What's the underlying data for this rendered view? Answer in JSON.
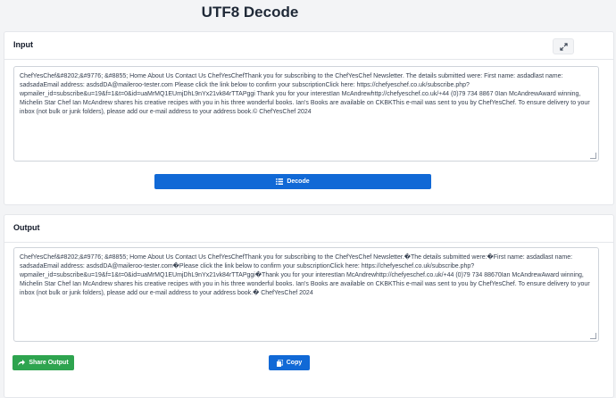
{
  "page": {
    "title": "UTF8 Decode"
  },
  "input": {
    "header": "Input",
    "text": "ChefYesChef&#8202;&#9776; &#8855; Home  About Us  Contact Us ChefYesChefThank you for subscribing to the ChefYesChef Newsletter. The details submitted were: First name: asdadlast name: sadsadaEmail address: asdsdDA@maileroo-tester.com Please click the link below to confirm your subscriptionClick here: https://chefyeschef.co.uk/subscribe.php?wpmailer_id=subscribe&u=19&f=1&t=0&id=uaMrMQ1EUmjDhL9nYx21vk84rTTAPggi Thank you for your interestIan McAndrewhttp://chefyeschef.co.uk/+44 (0)79 734 8867 0Ian McAndrewAward winning, Michelin Star Chef Ian McAndrew shares his creative recipes with you in his three wonderful books. Ian's Books are available on CKBKThis e-mail was sent to you by ChefYesChef. To ensure delivery to your inbox (not bulk or junk folders), please add our e-mail address to your address book.© ChefYesChef 2024"
  },
  "decode_button": {
    "label": "Decode",
    "icon": "list-icon"
  },
  "output": {
    "header": "Output",
    "text": "ChefYesChef&#8202;&#9776; &#8855; Home  About Us  Contact Us ChefYesChefThank you for subscribing to the ChefYesChef Newsletter.�The details submitted were:�First name: asdadlast name: sadsadaEmail address: asdsdDA@maileroo-tester.com�Please click the link below to confirm your subscriptionClick here: https://chefyeschef.co.uk/subscribe.php?wpmailer_id=subscribe&u=19&f=1&t=0&id=uaMrMQ1EUmjDhL9nYx21vk84rTTAPggi�Thank you for your interestIan McAndrewhttp://chefyeschef.co.uk/+44 (0)79 734 88670Ian McAndrewAward winning, Michelin Star Chef Ian McAndrew shares his creative recipes with you in his three wonderful books. Ian's Books are available on CKBKThis e-mail was sent to you by ChefYesChef. To ensure delivery to your inbox (not bulk or junk folders), please add our e-mail address to your address book.� ChefYesChef 2024"
  },
  "share_button": {
    "label": "Share Output",
    "icon": "share-icon"
  },
  "copy_button": {
    "label": "Copy",
    "icon": "copy-icon"
  },
  "colors": {
    "primary": "#1169d6",
    "success": "#2ea44f",
    "background": "#f3f4f6"
  }
}
